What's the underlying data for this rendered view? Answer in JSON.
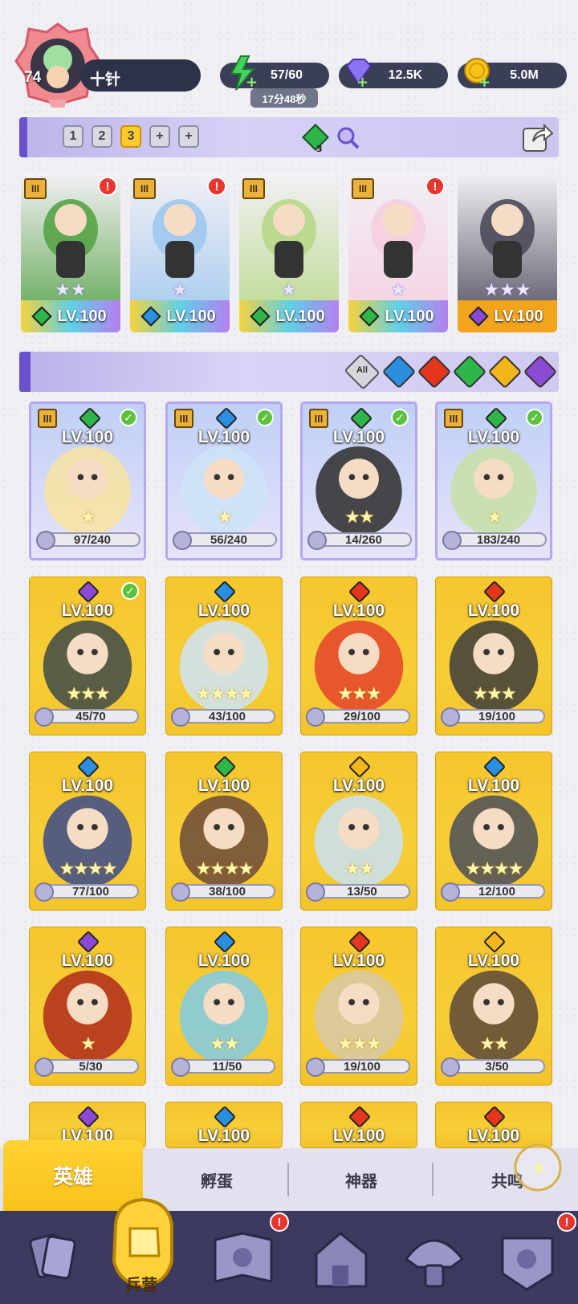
{
  "player": {
    "level": "74",
    "name": "十针"
  },
  "resources": {
    "energy": "57/60",
    "energy_timer": "17分48秒",
    "gems": "12.5K",
    "coins": "5.0M"
  },
  "teams": {
    "tabs": [
      "1",
      "2",
      "3",
      "+",
      "+"
    ],
    "active": "3",
    "badge": "3"
  },
  "team_heroes": [
    {
      "level": "LV.100",
      "stars": 2,
      "element": "wind",
      "rank": "III",
      "alert": true
    },
    {
      "level": "LV.100",
      "stars": 1,
      "element": "water",
      "rank": "III",
      "alert": true
    },
    {
      "level": "LV.100",
      "stars": 1,
      "element": "wind",
      "rank": "III",
      "alert": false
    },
    {
      "level": "LV.100",
      "stars": 1,
      "element": "wind",
      "rank": "III",
      "alert": true
    },
    {
      "level": "LV.100",
      "stars": 3,
      "element": "dark",
      "rank": "",
      "alert": false
    }
  ],
  "filters": [
    "All",
    "water",
    "fire",
    "wind",
    "light",
    "dark"
  ],
  "filter_all_label": "All",
  "heroes": [
    {
      "level": "LV.100",
      "progress": "97/240",
      "element": "wind",
      "stars": "★",
      "style": "purple",
      "check": true,
      "rank": "III"
    },
    {
      "level": "LV.100",
      "progress": "56/240",
      "element": "water",
      "stars": "★",
      "style": "purple",
      "check": true,
      "rank": "III"
    },
    {
      "level": "LV.100",
      "progress": "14/260",
      "element": "wind",
      "stars": "★★",
      "style": "purple",
      "check": true,
      "rank": "III"
    },
    {
      "level": "LV.100",
      "progress": "183/240",
      "element": "wind",
      "stars": "★",
      "style": "purple",
      "check": true,
      "rank": "III"
    },
    {
      "level": "LV.100",
      "progress": "45/70",
      "element": "dark",
      "stars": "★★★",
      "style": "gold",
      "check": true,
      "rank": ""
    },
    {
      "level": "LV.100",
      "progress": "43/100",
      "element": "water",
      "stars": "★★★★",
      "style": "gold",
      "check": false,
      "rank": ""
    },
    {
      "level": "LV.100",
      "progress": "29/100",
      "element": "fire",
      "stars": "★★★",
      "style": "gold",
      "check": false,
      "rank": ""
    },
    {
      "level": "LV.100",
      "progress": "19/100",
      "element": "fire",
      "stars": "★★★",
      "style": "gold",
      "check": false,
      "rank": ""
    },
    {
      "level": "LV.100",
      "progress": "77/100",
      "element": "water",
      "stars": "★★★★",
      "style": "gold",
      "check": false,
      "rank": ""
    },
    {
      "level": "LV.100",
      "progress": "38/100",
      "element": "wind",
      "stars": "★★★★",
      "style": "gold",
      "check": false,
      "rank": ""
    },
    {
      "level": "LV.100",
      "progress": "13/50",
      "element": "light",
      "stars": "★★",
      "style": "gold",
      "check": false,
      "rank": ""
    },
    {
      "level": "LV.100",
      "progress": "12/100",
      "element": "water",
      "stars": "★★★★",
      "style": "gold",
      "check": false,
      "rank": ""
    },
    {
      "level": "LV.100",
      "progress": "5/30",
      "element": "dark",
      "stars": "★",
      "style": "gold",
      "check": false,
      "rank": ""
    },
    {
      "level": "LV.100",
      "progress": "11/50",
      "element": "water",
      "stars": "★★",
      "style": "gold",
      "check": false,
      "rank": ""
    },
    {
      "level": "LV.100",
      "progress": "19/100",
      "element": "fire",
      "stars": "★★★",
      "style": "gold",
      "check": false,
      "rank": ""
    },
    {
      "level": "LV.100",
      "progress": "3/50",
      "element": "light",
      "stars": "★★",
      "style": "gold",
      "check": false,
      "rank": ""
    }
  ],
  "partial_row": [
    {
      "level": "LV.100",
      "element": "dark"
    },
    {
      "level": "LV.100",
      "element": "water"
    },
    {
      "level": "LV.100",
      "element": "fire"
    },
    {
      "level": "LV.100",
      "element": "fire"
    }
  ],
  "tabs": {
    "heroes": "英雄",
    "hatch": "孵蛋",
    "artifacts": "神器",
    "resonance": "共鸣"
  },
  "nav": {
    "barracks": "兵营"
  },
  "colors": {
    "wind": "#2fb64b",
    "water": "#2a8fe0",
    "fire": "#e3361c",
    "light": "#f2b61b",
    "dark": "#8b4ad6",
    "accent": "#6a52cc"
  }
}
